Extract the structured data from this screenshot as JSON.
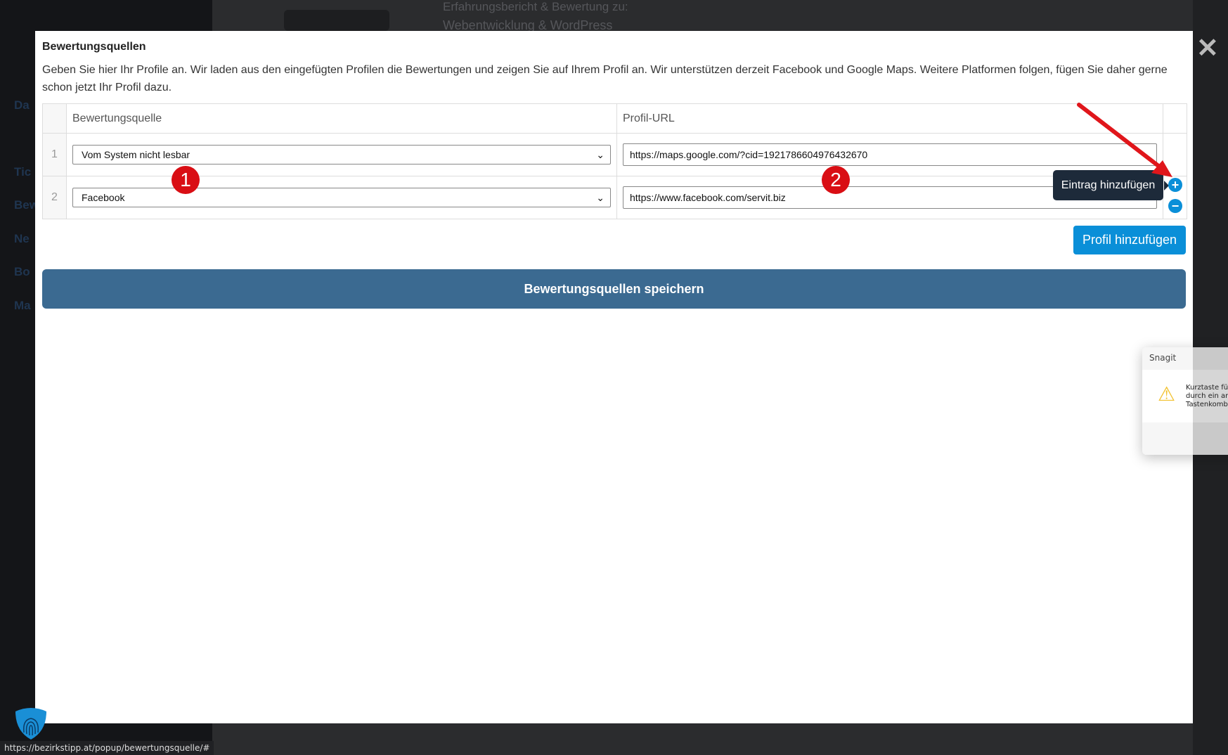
{
  "background": {
    "header_line1": "Erfahrungsbericht & Bewertung zu:",
    "header_line2": "Webentwicklung & WordPress",
    "sidebar_fragments": [
      "Da",
      "Tic",
      "Bew",
      "Ne",
      "Bo",
      "Ma"
    ]
  },
  "modal": {
    "title": "Bewertungsquellen",
    "description": "Geben Sie hier Ihr Profile an. Wir laden aus den eingefügten Profilen die Bewertungen und zeigen Sie auf Ihrem Profil an. Wir unterstützen derzeit Facebook und Google Maps. Weitere Platformen folgen, fügen Sie daher gerne schon jetzt Ihr Profil dazu.",
    "table": {
      "headers": [
        "Bewertungsquelle",
        "Profil-URL"
      ],
      "rows": [
        {
          "num": "1",
          "source": "Vom System nicht lesbar",
          "url": "https://maps.google.com/?cid=1921786604976432670"
        },
        {
          "num": "2",
          "source": "Facebook",
          "url": "https://www.facebook.com/servit.biz"
        }
      ]
    },
    "tooltip": "Eintrag hinzufügen",
    "add_profile_label": "Profil hinzufügen",
    "save_label": "Bewertungsquellen speichern",
    "annotations": [
      "1",
      "2"
    ],
    "accent_color": "#0a8fd8",
    "save_color": "#3b6a91"
  },
  "snagit": {
    "title": "Snagit",
    "message": "Kurztaste fü\ndurch ein ar\nTastenkomb"
  },
  "status_url": "https://bezirkstipp.at/popup/bewertungsquelle/#"
}
